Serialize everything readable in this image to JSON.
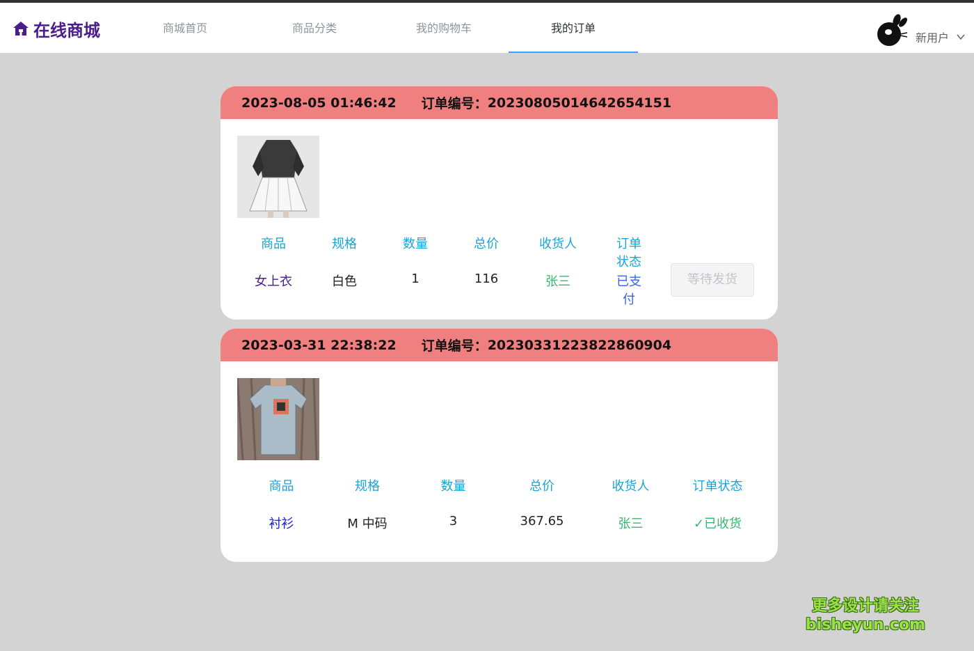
{
  "header": {
    "logo_text": "在线商城",
    "nav": [
      {
        "label": "商城首页",
        "active": false
      },
      {
        "label": "商品分类",
        "active": false
      },
      {
        "label": "我的购物车",
        "active": false
      },
      {
        "label": "我的订单",
        "active": true
      }
    ],
    "user_name": "新用户"
  },
  "columns": [
    "商品",
    "规格",
    "数量",
    "总价",
    "收货人",
    "订单状态"
  ],
  "order_id_label": "订单编号：",
  "orders": [
    {
      "time": "2023-08-05 01:46:42",
      "order_no": "20230805014642654151",
      "product": "女上衣",
      "spec": "白色",
      "quantity": "1",
      "total": "116",
      "receiver": "张三",
      "status": "已支付",
      "action": "等待发货"
    },
    {
      "time": "2023-03-31 22:38:22",
      "order_no": "20230331223822860904",
      "product": "衬衫",
      "spec": "M 中码",
      "quantity": "3",
      "total": "367.65",
      "receiver": "张三",
      "status": "✓已收货"
    }
  ],
  "colors": {
    "brand": "#4b1c8c",
    "header_band": "#f08080",
    "column_head": "#1aa3d6",
    "receiver": "#3cb371",
    "status_paid": "#3366e6",
    "status_received": "#3cb371"
  },
  "watermark": {
    "line1": "更多设计请关注",
    "line2": "bisheyun.com"
  }
}
